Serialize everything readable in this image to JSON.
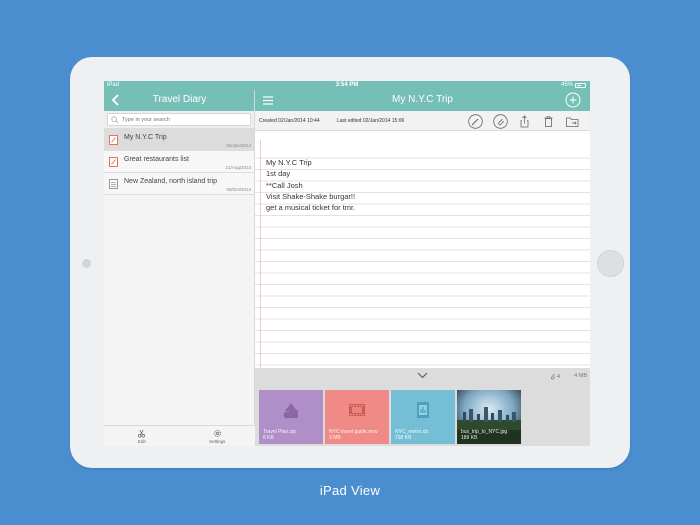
{
  "status_bar": {
    "carrier": "iPad",
    "time": "3:54 PM",
    "battery": "45%"
  },
  "sidebar": {
    "title": "Travel Diary",
    "search_placeholder": "Type in your search",
    "notes": [
      {
        "title": "My N.Y.C Trip",
        "date": "02/Jan/2014",
        "selected": true
      },
      {
        "title": "Great restaurants list",
        "date": "21/Aug/2013",
        "selected": false
      },
      {
        "title": "New Zealand, north island trip",
        "date": "08/Oct/2013",
        "selected": false
      }
    ],
    "footer": {
      "edit_label": "Edit",
      "settings_label": "Settings"
    }
  },
  "main": {
    "title": "My N.Y.C Trip",
    "created": "Created 02/Jan/2014 10:44",
    "edited": "Last edited 02/Jan/2014 15:06",
    "lines": [
      "My N.Y.C Trip",
      "1st day",
      "**Call Josh",
      "Visit Shake-Shake burgar!!",
      "get a musical ticket for tmr."
    ],
    "attachments": {
      "count": "4",
      "total_size": "4 MB",
      "items": [
        {
          "name": "Travel Plan.zip",
          "size": "8 KB",
          "color": "#b08fc9",
          "icon": "shapes-icon"
        },
        {
          "name": "NYC travel guide.mov",
          "size": "3 MB",
          "color": "#ef8a86",
          "icon": "film-icon"
        },
        {
          "name": "NYC_metro.xls",
          "size": "798 KB",
          "color": "#74bfd6",
          "icon": "spreadsheet-icon"
        },
        {
          "name": "bus_trip_to_NYC.jpg",
          "size": "189 KB",
          "color": "#3c5a72",
          "icon": "photo-thumbnail"
        }
      ]
    }
  },
  "caption": "iPad View",
  "colors": {
    "background": "#4a8ed0",
    "header": "#76bfb6",
    "note_icon": "#e0775a"
  }
}
